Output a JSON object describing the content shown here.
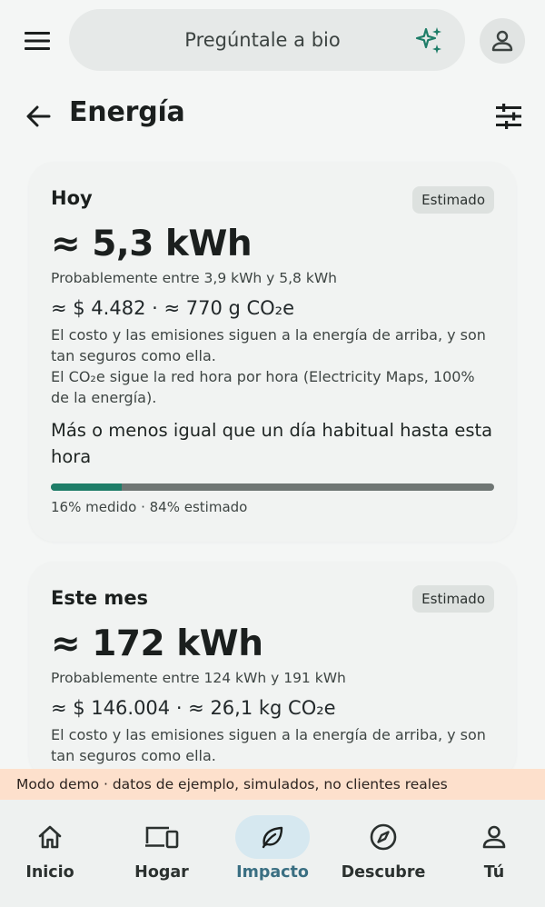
{
  "search": {
    "placeholder": "Pregúntale a bio"
  },
  "header": {
    "title": "Energía"
  },
  "today": {
    "label": "Hoy",
    "badge": "Estimado",
    "value": "≈ 5,3 kWh",
    "range": "Probablemente entre 3,9 kWh y 5,8 kWh",
    "cost": "≈ $ 4.482  ·  ≈ 770 g CO₂e",
    "note_1": "El costo y las emisiones siguen a la energía de arriba, y son tan seguros como ella.",
    "note_2": "El CO₂e sigue la red hora por hora (Electricity Maps, 100% de la energía).",
    "comparison": "Más o menos igual que un día habitual hasta esta hora",
    "measured_fraction": 0.16,
    "bar_caption": "16% medido · 84% estimado"
  },
  "month": {
    "label": "Este mes",
    "badge": "Estimado",
    "value": "≈ 172 kWh",
    "range": "Probablemente entre 124 kWh y 191 kWh",
    "cost": "≈ $ 146.004  ·  ≈ 26,1 kg CO₂e",
    "note_1": "El costo y las emisiones siguen a la energía de arriba, y son tan seguros como ella."
  },
  "demo_banner": "Modo demo · datos de ejemplo, simulados, no clientes reales",
  "nav": {
    "items": [
      {
        "label": "Inicio",
        "icon": "home-icon"
      },
      {
        "label": "Hogar",
        "icon": "devices-icon"
      },
      {
        "label": "Impacto",
        "icon": "leaf-icon",
        "active": true
      },
      {
        "label": "Descubre",
        "icon": "compass-icon"
      },
      {
        "label": "Tú",
        "icon": "person-icon"
      }
    ]
  },
  "colors": {
    "accent": "#1e7d68",
    "nav_active": "#3a6f82",
    "nav_active_bg": "#d6e8f0",
    "demo_bg": "#fde0cc"
  }
}
